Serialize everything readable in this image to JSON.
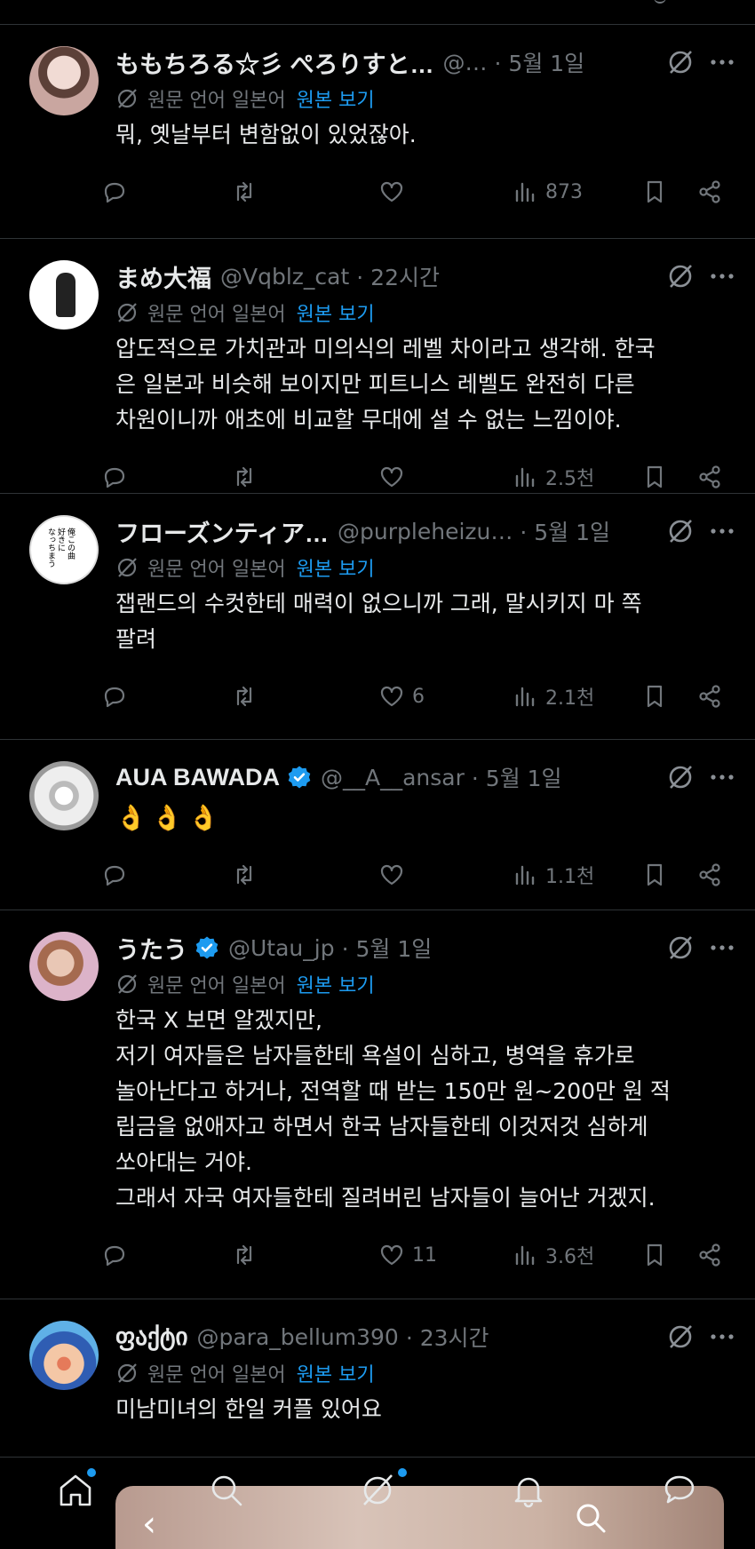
{
  "colors": {
    "background": "#000000",
    "text": "#e7e9ea",
    "muted": "#71767b",
    "link": "#1d9bf0",
    "divider": "#2f3336"
  },
  "translation": {
    "label": "원문 언어 일본어",
    "link": "원본 보기"
  },
  "posts": [
    {
      "name": "ももちろる☆彡 ぺろりすと…",
      "handle": "@…",
      "date": "· 5월 1일",
      "verified": false,
      "translated": true,
      "text": "뭐, 옛날부터 변함없이 있었잖아.",
      "replies": "",
      "reposts": "",
      "likes": "",
      "views": "873"
    },
    {
      "name": "まめ大福",
      "handle": "@Vqblz_cat",
      "date": "· 22시간",
      "verified": false,
      "translated": true,
      "text": "압도적으로 가치관과 미의식의 레벨 차이라고 생각해. 한국\n은 일본과 비슷해 보이지만 피트니스 레벨도 완전히 다른\n차원이니까 애초에 비교할 무대에 설 수 없는 느낌이야.",
      "replies": "",
      "reposts": "",
      "likes": "",
      "views": "2.5천"
    },
    {
      "name": "フローズンティア…",
      "handle": "@purpleheizu…",
      "date": "· 5월 1일",
      "verified": false,
      "translated": true,
      "text": "잽랜드의 수컷한테 매력이 없으니까 그래, 말시키지 마 쪽\n팔려",
      "replies": "",
      "reposts": "",
      "likes": "6",
      "views": "2.1천"
    },
    {
      "name": "AUA BAWADA",
      "handle": "@__A__ansar",
      "date": "· 5월 1일",
      "verified": true,
      "translated": false,
      "text": "👌👌👌",
      "replies": "",
      "reposts": "",
      "likes": "",
      "views": "1.1천"
    },
    {
      "name": "うたう",
      "handle": "@Utau_jp",
      "date": "· 5월 1일",
      "verified": true,
      "translated": true,
      "text": "한국 X 보면 알겠지만,\n저기 여자들은 남자들한테 욕설이 심하고, 병역을 휴가로\n놀아난다고 하거나, 전역할 때 받는 150만 원~200만 원 적\n립금을 없애자고 하면서 한국 남자들한테 이것저것 심하게\n쏘아대는 거야.\n그래서 자국 여자들한테 질려버린 남자들이 늘어난 거겠지.",
      "replies": "",
      "reposts": "",
      "likes": "11",
      "views": "3.6천"
    },
    {
      "name": "ფაქტი",
      "handle": "@para_bellum390",
      "date": "· 23시간",
      "verified": false,
      "translated": true,
      "text": "미남미녀의 한일 커플 있어요",
      "replies": "",
      "reposts": "",
      "likes": "",
      "views": ""
    }
  ],
  "nav": {
    "items": [
      "home-icon",
      "search-icon",
      "grok-icon",
      "notifications-icon",
      "messages-icon"
    ],
    "pip_back": "‹"
  }
}
